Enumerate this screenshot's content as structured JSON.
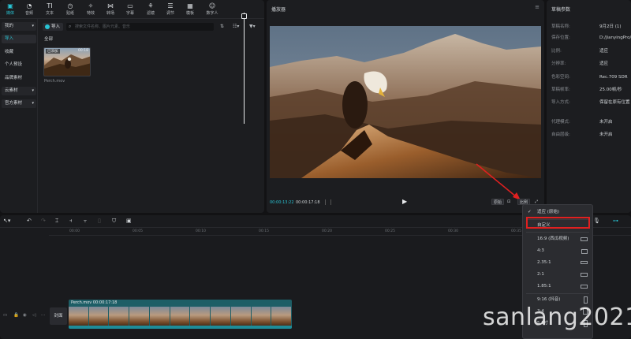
{
  "toolbar": {
    "items": [
      {
        "label": "媒体",
        "icon": "media-icon"
      },
      {
        "label": "音频",
        "icon": "audio-icon"
      },
      {
        "label": "文本",
        "icon": "text-icon"
      },
      {
        "label": "贴纸",
        "icon": "sticker-icon"
      },
      {
        "label": "特效",
        "icon": "effects-icon"
      },
      {
        "label": "转场",
        "icon": "transition-icon"
      },
      {
        "label": "字幕",
        "icon": "subtitle-icon"
      },
      {
        "label": "滤镜",
        "icon": "filter-icon"
      },
      {
        "label": "调节",
        "icon": "adjust-icon"
      },
      {
        "label": "模板",
        "icon": "template-icon"
      },
      {
        "label": "数字人",
        "icon": "digital-human-icon"
      }
    ]
  },
  "sidebar": {
    "items": [
      {
        "label": "我的"
      },
      {
        "label": "导入"
      },
      {
        "label": "收藏"
      },
      {
        "label": "个人预设"
      },
      {
        "label": "品牌素材"
      },
      {
        "label": "云素材"
      },
      {
        "label": "官方素材"
      }
    ]
  },
  "media": {
    "import_label": "导入",
    "search_placeholder": "搜索文件名称、图片元素、音乐",
    "all_label": "全部",
    "clip": {
      "badge": "已添加",
      "duration": "00:18",
      "name": "Perch.mov"
    }
  },
  "player": {
    "title": "播放器",
    "current_time": "00:00:13:22",
    "total_time": "00:00:17:18",
    "btn_original": "原始",
    "btn_ratio": "比例"
  },
  "draft": {
    "title": "草稿参数",
    "rows": [
      {
        "k": "草稿名称:",
        "v": "9月2日 (1)"
      },
      {
        "k": "保存位置:",
        "v": "D:/JianyingPro/Jiany"
      },
      {
        "k": "比例:",
        "v": "适应"
      },
      {
        "k": "分辨率:",
        "v": "适应"
      },
      {
        "k": "色彩空间:",
        "v": "Rec.709 SDR"
      },
      {
        "k": "草稿帧率:",
        "v": "25.00帧/秒"
      },
      {
        "k": "导入方式:",
        "v": "保留在原有位置"
      },
      {
        "k": "代理模式:",
        "v": "未开启"
      },
      {
        "k": "自由层级:",
        "v": "未开启"
      }
    ]
  },
  "timeline": {
    "ruler": [
      "00:00",
      "00:05",
      "00:10",
      "00:15",
      "00:20",
      "00:25",
      "00:30",
      "00:35"
    ],
    "cover_label": "封面",
    "clip_label": "Perch.mov  00:00:17:18"
  },
  "ratio_menu": {
    "items": [
      {
        "label": "适应 (原始)",
        "checked": true
      },
      {
        "label": "自定义",
        "checked": false
      },
      {
        "label": "16:9 (西瓜视频)",
        "checked": false
      },
      {
        "label": "4:3",
        "checked": false
      },
      {
        "label": "2.35:1",
        "checked": false
      },
      {
        "label": "2:1",
        "checked": false
      },
      {
        "label": "1.85:1",
        "checked": false
      },
      {
        "label": "9:16 (抖音)",
        "checked": false
      },
      {
        "label": "3:4",
        "checked": false
      },
      {
        "label": "5.8寸",
        "checked": false
      }
    ]
  },
  "watermark": "sanlang2021",
  "colors": {
    "accent": "#29c4d4",
    "highlight": "#e02020",
    "clip": "#1d5e66"
  }
}
